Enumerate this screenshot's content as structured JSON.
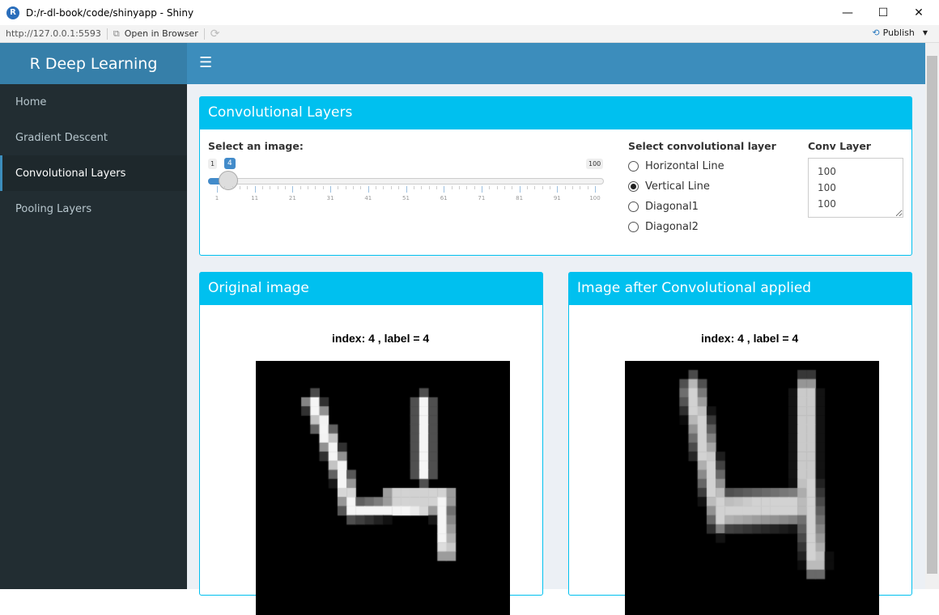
{
  "window": {
    "title": "D:/r-dl-book/code/shinyapp - Shiny",
    "url": "http://127.0.0.1:5593",
    "open_browser": "Open in Browser",
    "publish": "Publish"
  },
  "app": {
    "brand": "R Deep Learning"
  },
  "sidebar": {
    "items": [
      {
        "label": "Home"
      },
      {
        "label": "Gradient Descent"
      },
      {
        "label": "Convolutional Layers"
      },
      {
        "label": "Pooling Layers"
      }
    ]
  },
  "controls": {
    "title": "Convolutional Layers",
    "slider_label": "Select an image:",
    "slider_min": "1",
    "slider_max": "100",
    "slider_value": "4",
    "ticks": [
      "1",
      "11",
      "21",
      "31",
      "41",
      "51",
      "61",
      "71",
      "81",
      "91",
      "100"
    ],
    "radio_label": "Select convolutional layer",
    "radios": [
      "Horizontal Line",
      "Vertical Line",
      "Diagonal1",
      "Diagonal2"
    ],
    "selected_radio": "Vertical Line",
    "conv_label": "Conv Layer",
    "conv_value": "100\n100\n100"
  },
  "original": {
    "title": "Original image",
    "plot_title": "index: 4 , label = 4"
  },
  "convolved": {
    "title": "Image after Convolutional applied",
    "plot_title": "index: 4 , label = 4"
  },
  "colors": {
    "header": "#3c8dbc",
    "box": "#00c0ef",
    "sidebar": "#222d32"
  }
}
